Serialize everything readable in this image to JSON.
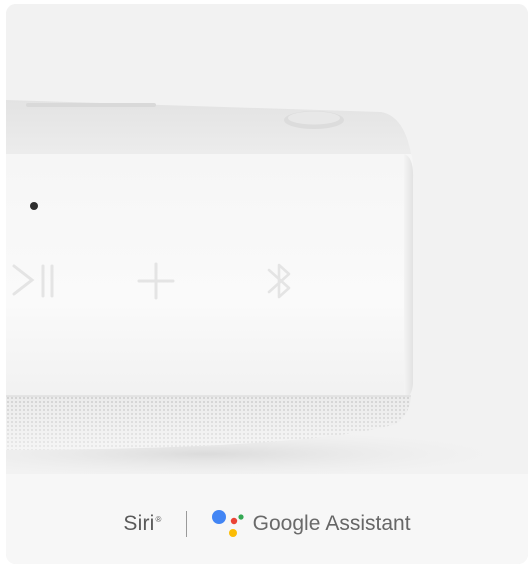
{
  "assistants": {
    "siri_label": "Siri",
    "siri_mark": "®",
    "google_label": "Google",
    "assistant_label": "Assistant"
  },
  "icons": [
    "play-pause-icon",
    "plus-icon",
    "bluetooth-icon",
    "google-assistant-logo"
  ],
  "colors": {
    "speaker_body": "#f2f2f2",
    "background": "#f0f0f0",
    "text": "#5f5f5f",
    "ga_blue": "#4285F4",
    "ga_red": "#EA4335",
    "ga_yellow": "#FBBC05",
    "ga_green": "#34A853"
  }
}
